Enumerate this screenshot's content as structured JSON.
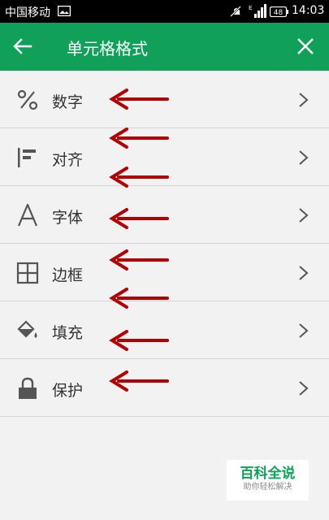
{
  "status_bar": {
    "carrier": "中国移动",
    "battery": "48",
    "time": "14:03",
    "icons": [
      "image-icon",
      "mute-icon",
      "signal-icon",
      "battery-icon"
    ]
  },
  "header": {
    "title": "单元格格式",
    "back_icon": "back-arrow-icon",
    "close_icon": "close-icon",
    "color": "#10a05a"
  },
  "menu": {
    "items": [
      {
        "label": "数字",
        "icon": "percent-icon"
      },
      {
        "label": "对齐",
        "icon": "align-icon"
      },
      {
        "label": "字体",
        "icon": "font-icon"
      },
      {
        "label": "边框",
        "icon": "border-icon"
      },
      {
        "label": "填充",
        "icon": "fill-bucket-icon"
      },
      {
        "label": "保护",
        "icon": "lock-icon"
      }
    ]
  },
  "annotations": {
    "arrow_color": "#b00000",
    "arrow_count": 8
  },
  "watermark": {
    "main": "百科全说",
    "sub": "助你轻松解决"
  }
}
